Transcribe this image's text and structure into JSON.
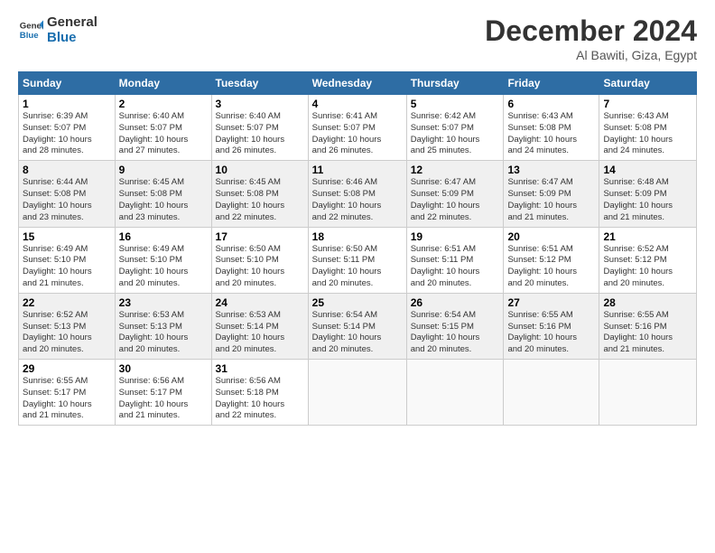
{
  "header": {
    "logo_line1": "General",
    "logo_line2": "Blue",
    "month": "December 2024",
    "location": "Al Bawiti, Giza, Egypt"
  },
  "days_of_week": [
    "Sunday",
    "Monday",
    "Tuesday",
    "Wednesday",
    "Thursday",
    "Friday",
    "Saturday"
  ],
  "weeks": [
    [
      {
        "day": "1",
        "info": "Sunrise: 6:39 AM\nSunset: 5:07 PM\nDaylight: 10 hours\nand 28 minutes."
      },
      {
        "day": "2",
        "info": "Sunrise: 6:40 AM\nSunset: 5:07 PM\nDaylight: 10 hours\nand 27 minutes."
      },
      {
        "day": "3",
        "info": "Sunrise: 6:40 AM\nSunset: 5:07 PM\nDaylight: 10 hours\nand 26 minutes."
      },
      {
        "day": "4",
        "info": "Sunrise: 6:41 AM\nSunset: 5:07 PM\nDaylight: 10 hours\nand 26 minutes."
      },
      {
        "day": "5",
        "info": "Sunrise: 6:42 AM\nSunset: 5:07 PM\nDaylight: 10 hours\nand 25 minutes."
      },
      {
        "day": "6",
        "info": "Sunrise: 6:43 AM\nSunset: 5:08 PM\nDaylight: 10 hours\nand 24 minutes."
      },
      {
        "day": "7",
        "info": "Sunrise: 6:43 AM\nSunset: 5:08 PM\nDaylight: 10 hours\nand 24 minutes."
      }
    ],
    [
      {
        "day": "8",
        "info": "Sunrise: 6:44 AM\nSunset: 5:08 PM\nDaylight: 10 hours\nand 23 minutes."
      },
      {
        "day": "9",
        "info": "Sunrise: 6:45 AM\nSunset: 5:08 PM\nDaylight: 10 hours\nand 23 minutes."
      },
      {
        "day": "10",
        "info": "Sunrise: 6:45 AM\nSunset: 5:08 PM\nDaylight: 10 hours\nand 22 minutes."
      },
      {
        "day": "11",
        "info": "Sunrise: 6:46 AM\nSunset: 5:08 PM\nDaylight: 10 hours\nand 22 minutes."
      },
      {
        "day": "12",
        "info": "Sunrise: 6:47 AM\nSunset: 5:09 PM\nDaylight: 10 hours\nand 22 minutes."
      },
      {
        "day": "13",
        "info": "Sunrise: 6:47 AM\nSunset: 5:09 PM\nDaylight: 10 hours\nand 21 minutes."
      },
      {
        "day": "14",
        "info": "Sunrise: 6:48 AM\nSunset: 5:09 PM\nDaylight: 10 hours\nand 21 minutes."
      }
    ],
    [
      {
        "day": "15",
        "info": "Sunrise: 6:49 AM\nSunset: 5:10 PM\nDaylight: 10 hours\nand 21 minutes."
      },
      {
        "day": "16",
        "info": "Sunrise: 6:49 AM\nSunset: 5:10 PM\nDaylight: 10 hours\nand 20 minutes."
      },
      {
        "day": "17",
        "info": "Sunrise: 6:50 AM\nSunset: 5:10 PM\nDaylight: 10 hours\nand 20 minutes."
      },
      {
        "day": "18",
        "info": "Sunrise: 6:50 AM\nSunset: 5:11 PM\nDaylight: 10 hours\nand 20 minutes."
      },
      {
        "day": "19",
        "info": "Sunrise: 6:51 AM\nSunset: 5:11 PM\nDaylight: 10 hours\nand 20 minutes."
      },
      {
        "day": "20",
        "info": "Sunrise: 6:51 AM\nSunset: 5:12 PM\nDaylight: 10 hours\nand 20 minutes."
      },
      {
        "day": "21",
        "info": "Sunrise: 6:52 AM\nSunset: 5:12 PM\nDaylight: 10 hours\nand 20 minutes."
      }
    ],
    [
      {
        "day": "22",
        "info": "Sunrise: 6:52 AM\nSunset: 5:13 PM\nDaylight: 10 hours\nand 20 minutes."
      },
      {
        "day": "23",
        "info": "Sunrise: 6:53 AM\nSunset: 5:13 PM\nDaylight: 10 hours\nand 20 minutes."
      },
      {
        "day": "24",
        "info": "Sunrise: 6:53 AM\nSunset: 5:14 PM\nDaylight: 10 hours\nand 20 minutes."
      },
      {
        "day": "25",
        "info": "Sunrise: 6:54 AM\nSunset: 5:14 PM\nDaylight: 10 hours\nand 20 minutes."
      },
      {
        "day": "26",
        "info": "Sunrise: 6:54 AM\nSunset: 5:15 PM\nDaylight: 10 hours\nand 20 minutes."
      },
      {
        "day": "27",
        "info": "Sunrise: 6:55 AM\nSunset: 5:16 PM\nDaylight: 10 hours\nand 20 minutes."
      },
      {
        "day": "28",
        "info": "Sunrise: 6:55 AM\nSunset: 5:16 PM\nDaylight: 10 hours\nand 21 minutes."
      }
    ],
    [
      {
        "day": "29",
        "info": "Sunrise: 6:55 AM\nSunset: 5:17 PM\nDaylight: 10 hours\nand 21 minutes."
      },
      {
        "day": "30",
        "info": "Sunrise: 6:56 AM\nSunset: 5:17 PM\nDaylight: 10 hours\nand 21 minutes."
      },
      {
        "day": "31",
        "info": "Sunrise: 6:56 AM\nSunset: 5:18 PM\nDaylight: 10 hours\nand 22 minutes."
      },
      {
        "day": "",
        "info": ""
      },
      {
        "day": "",
        "info": ""
      },
      {
        "day": "",
        "info": ""
      },
      {
        "day": "",
        "info": ""
      }
    ]
  ]
}
